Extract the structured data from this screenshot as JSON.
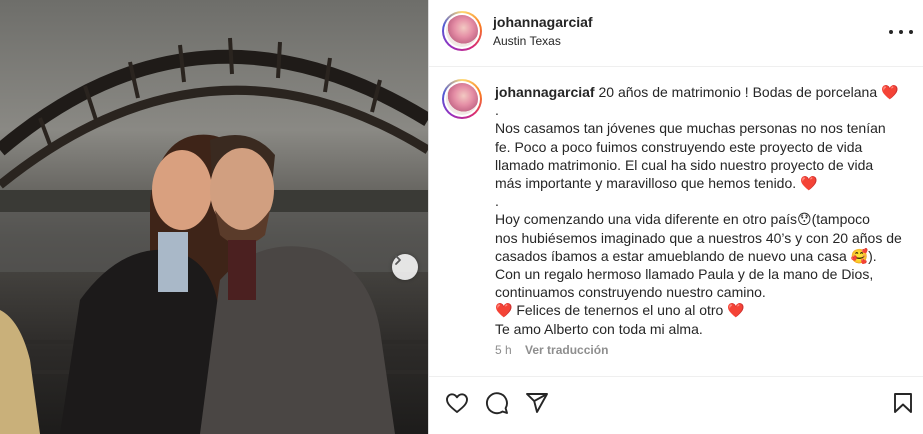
{
  "post": {
    "username": "johannagarciaf",
    "location": "Austin Texas"
  },
  "caption": {
    "username": "johannagarciaf",
    "lines": [
      "20 años de matrimonio ! Bodas de porcelana ❤️",
      ".",
      "Nos casamos tan jóvenes que muchas personas no nos tenían",
      "fe. Poco a poco fuimos construyendo este proyecto de vida",
      "llamado matrimonio. El cual ha sido nuestro proyecto de vida",
      "más importante y maravilloso que hemos tenido. ❤️",
      ".",
      "Hoy comenzando una vida diferente en otro país😯(tampoco",
      "nos hubiésemos imaginado que a nuestros 40’s y con 20 años de",
      "casados íbamos a estar amueblando de nuevo una casa 🥰).",
      "Con un regalo hermoso llamado Paula y de la mano de Dios,",
      "continuamos construyendo nuestro camino.",
      "❤️ Felices de tenernos el uno al otro ❤️",
      "Te amo Alberto con toda mi alma."
    ],
    "time": "5 h",
    "translate": "Ver traducción"
  },
  "icons": {
    "like": "heart-icon",
    "comment": "comment-icon",
    "share": "share-icon",
    "save": "bookmark-icon",
    "more": "more-icon",
    "next": "chevron-right-icon"
  }
}
